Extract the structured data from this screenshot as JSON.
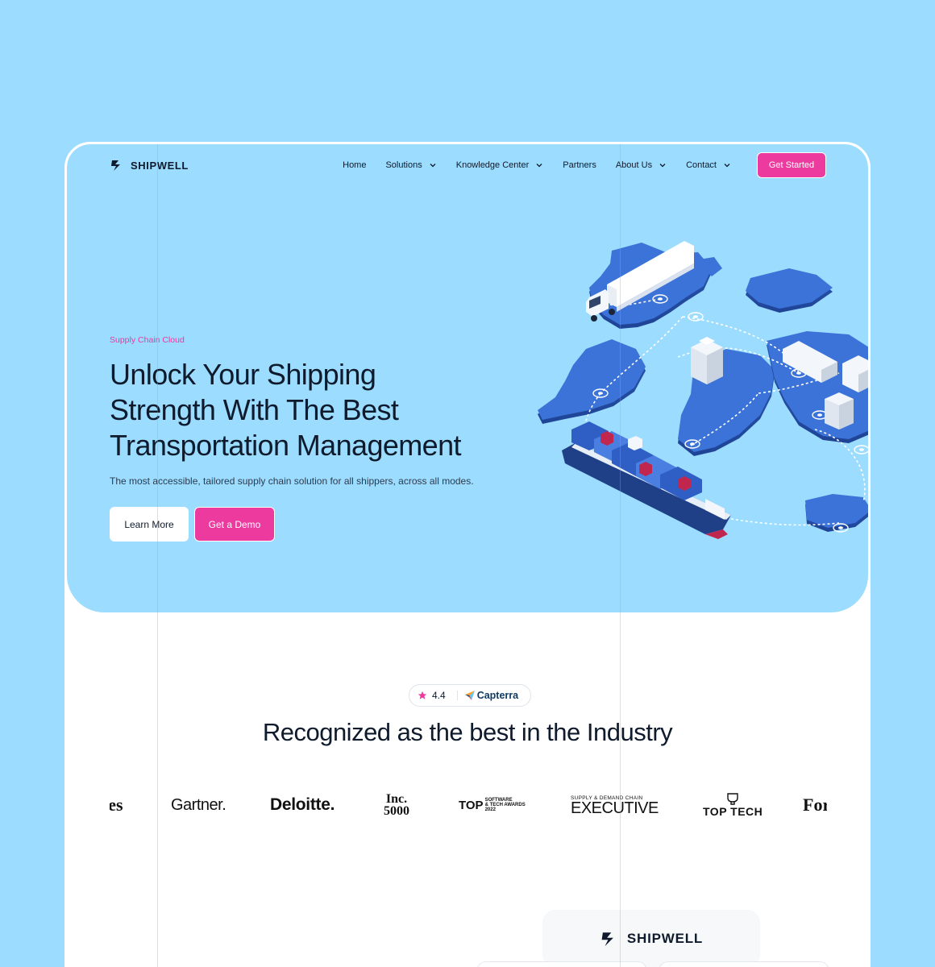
{
  "brand": {
    "name": "SHIPWELL"
  },
  "nav": {
    "items": [
      {
        "label": "Home",
        "dropdown": false
      },
      {
        "label": "Solutions",
        "dropdown": true
      },
      {
        "label": "Knowledge Center",
        "dropdown": true
      },
      {
        "label": "Partners",
        "dropdown": false
      },
      {
        "label": "About Us",
        "dropdown": true
      },
      {
        "label": "Contact",
        "dropdown": true
      }
    ],
    "cta": "Get Started"
  },
  "hero": {
    "eyebrow": "Supply Chain Cloud",
    "title_line1": "Unlock Your Shipping",
    "title_line2": "Strength With The Best",
    "title_line3": "Transportation Management",
    "subtitle": "The most accessible, tailored supply chain solution for all shippers, across all modes.",
    "learn_more": "Learn More",
    "get_demo": "Get a Demo"
  },
  "recognition": {
    "rating": "4.4",
    "rating_source": "Capterra",
    "title": "Recognized as the best in the Industry",
    "logos": {
      "forbes_left": "bes",
      "gartner": "Gartner.",
      "deloitte": "Deloitte.",
      "inc_top": "Inc.",
      "inc_bottom": "5000",
      "top_main": "TOP",
      "top_small1": "SOFTWARE",
      "top_small2": "& TECH AWARDS",
      "top_year": "2022",
      "exec_small": "SUPPLY & DEMAND CHAIN",
      "exec_main": "EXECUTIVE",
      "toptech": "TOP TECH",
      "forbes_right": "For"
    }
  },
  "colors": {
    "background": "#9bdcff",
    "accent": "#ec3a9e",
    "text": "#0f1b2d",
    "map": "#3b73d9"
  },
  "icons": [
    "shipwell-logo-icon",
    "chevron-down-icon",
    "star-icon",
    "capterra-icon"
  ]
}
